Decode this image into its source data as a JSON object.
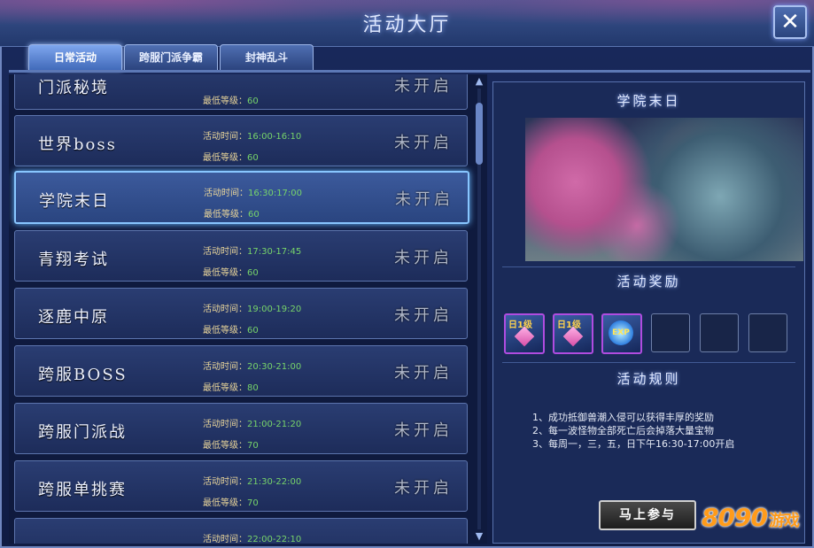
{
  "window": {
    "title": "活动大厅",
    "close_label": "✕"
  },
  "tabs": [
    {
      "label": "日常活动",
      "active": true
    },
    {
      "label": "跨服门派争霸",
      "active": false
    },
    {
      "label": "封神乱斗",
      "active": false
    }
  ],
  "labels": {
    "time": "活动时间：",
    "level": "最低等级："
  },
  "events": [
    {
      "name": "门派秘境",
      "time": "",
      "level": "60",
      "status": "未开启"
    },
    {
      "name": "世界boss",
      "time": "16:00-16:10",
      "level": "60",
      "status": "未开启"
    },
    {
      "name": "学院末日",
      "time": "16:30:17:00",
      "level": "60",
      "status": "未开启",
      "selected": true
    },
    {
      "name": "青翔考试",
      "time": "17:30-17:45",
      "level": "60",
      "status": "未开启"
    },
    {
      "name": "逐鹿中原",
      "time": "19:00-19:20",
      "level": "60",
      "status": "未开启"
    },
    {
      "name": "跨服BOSS",
      "time": "20:30-21:00",
      "level": "80",
      "status": "未开启"
    },
    {
      "name": "跨服门派战",
      "time": "21:00-21:20",
      "level": "70",
      "status": "未开启"
    },
    {
      "name": "跨服单挑赛",
      "time": "21:30-22:00",
      "level": "70",
      "status": "未开启"
    },
    {
      "name": "",
      "time": "22:00-22:10",
      "level": "",
      "status": ""
    }
  ],
  "detail": {
    "title": "学院末日",
    "reward_title": "活动奖励",
    "rewards": [
      {
        "type": "item",
        "badge": "日1级",
        "icon": "gem-icon"
      },
      {
        "type": "item",
        "badge": "日1级",
        "icon": "gem-icon"
      },
      {
        "type": "exp",
        "badge": "EXP",
        "icon": "exp-orb-icon"
      },
      {
        "type": "empty"
      },
      {
        "type": "empty"
      },
      {
        "type": "empty"
      }
    ],
    "rules_title": "活动规则",
    "rules": [
      "1、成功抵御兽潮入侵可以获得丰厚的奖励",
      "2、每一波怪物全部死亡后会掉落大量宝物",
      "3、每周一，三，五，日下午16:30-17:00开启"
    ],
    "join_label": "马上参与"
  },
  "watermark": {
    "text": "8090",
    "suffix": "游戏"
  }
}
